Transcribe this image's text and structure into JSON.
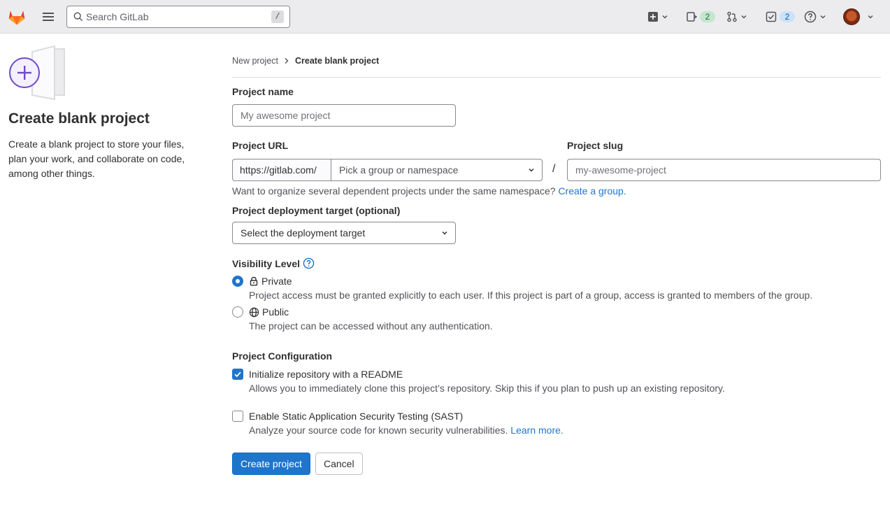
{
  "topbar": {
    "search_placeholder": "Search GitLab",
    "search_shortcut": "/",
    "issues_count": "2",
    "todos_count": "2"
  },
  "sidebar": {
    "title": "Create blank project",
    "description": "Create a blank project to store your files, plan your work, and collaborate on code, among other things."
  },
  "breadcrumb": {
    "parent": "New project",
    "current": "Create blank project"
  },
  "form": {
    "project_name_label": "Project name",
    "project_name_placeholder": "My awesome project",
    "project_url_label": "Project URL",
    "url_prefix": "https://gitlab.com/",
    "namespace_placeholder": "Pick a group or namespace",
    "url_separator": "/",
    "project_slug_label": "Project slug",
    "project_slug_placeholder": "my-awesome-project",
    "group_hint": "Want to organize several dependent projects under the same namespace?",
    "create_group_link": "Create a group.",
    "deployment_label": "Project deployment target (optional)",
    "deployment_placeholder": "Select the deployment target",
    "visibility_label": "Visibility Level",
    "visibility_options": [
      {
        "label": "Private",
        "help": "Project access must be granted explicitly to each user. If this project is part of a group, access is granted to members of the group.",
        "checked": true
      },
      {
        "label": "Public",
        "help": "The project can be accessed without any authentication.",
        "checked": false
      }
    ],
    "config_label": "Project Configuration",
    "config_options": [
      {
        "label": "Initialize repository with a README",
        "help": "Allows you to immediately clone this project’s repository. Skip this if you plan to push up an existing repository.",
        "checked": true
      },
      {
        "label": "Enable Static Application Security Testing (SAST)",
        "help": "Analyze your source code for known security vulnerabilities.",
        "link": "Learn more.",
        "checked": false
      }
    ],
    "create_button": "Create project",
    "cancel_button": "Cancel"
  },
  "colors": {
    "primary": "#1f75cb",
    "topbar_bg": "#ececef",
    "logo_orange": "#e24329"
  }
}
